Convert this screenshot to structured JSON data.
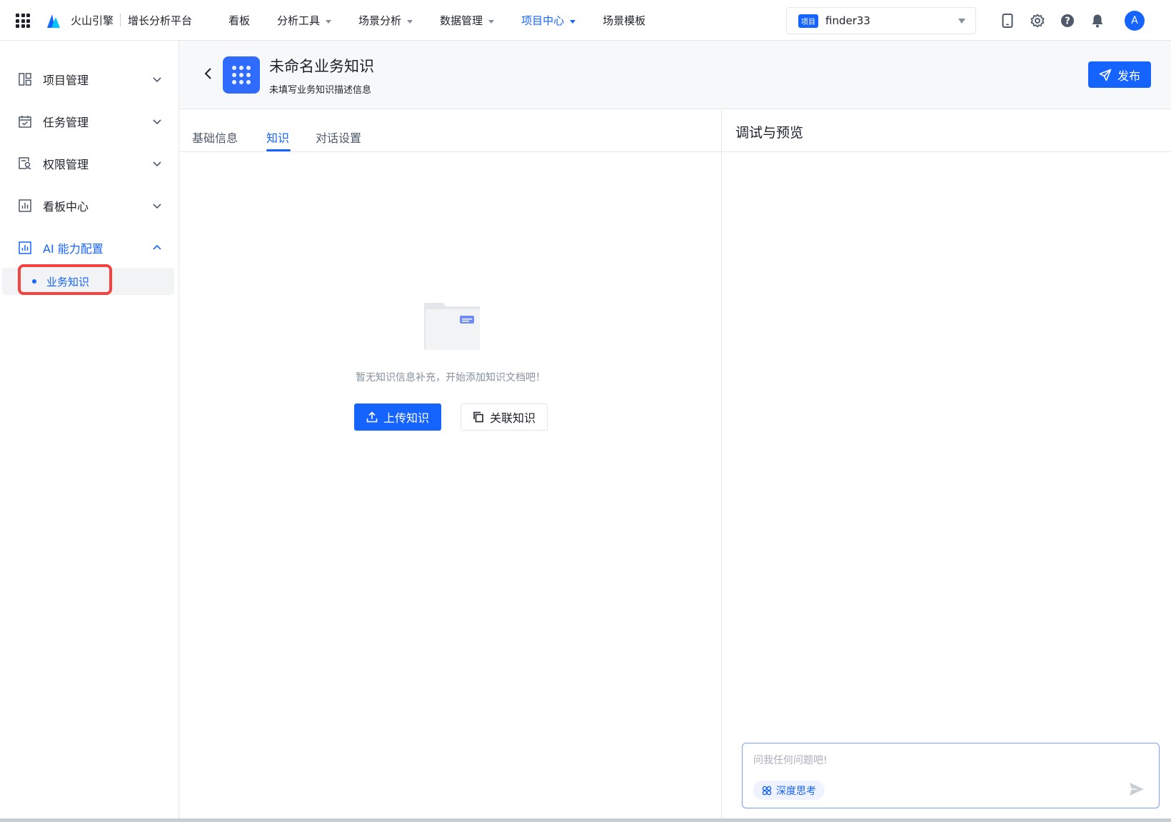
{
  "topbar": {
    "brand": "火山引擎",
    "platform": "增长分析平台",
    "nav": [
      {
        "label": "看板",
        "has_menu": false,
        "active": false
      },
      {
        "label": "分析工具",
        "has_menu": true,
        "active": false
      },
      {
        "label": "场景分析",
        "has_menu": true,
        "active": false
      },
      {
        "label": "数据管理",
        "has_menu": true,
        "active": false
      },
      {
        "label": "项目中心",
        "has_menu": true,
        "active": true
      },
      {
        "label": "场景模板",
        "has_menu": false,
        "active": false
      }
    ],
    "project_badge": "项目",
    "project_name": "finder33",
    "avatar_letter": "A",
    "icons": [
      "mobile-icon",
      "gear-icon",
      "help-icon",
      "bell-icon"
    ]
  },
  "sidebar": {
    "items": [
      {
        "label": "项目管理",
        "icon": "layout-icon",
        "expanded": false
      },
      {
        "label": "任务管理",
        "icon": "calendar-icon",
        "expanded": false
      },
      {
        "label": "权限管理",
        "icon": "user-search-icon",
        "expanded": false
      },
      {
        "label": "看板中心",
        "icon": "chart-icon",
        "expanded": false
      },
      {
        "label": "AI 能力配置",
        "icon": "ai-chart-icon",
        "expanded": true
      }
    ],
    "sub_item": {
      "label": "业务知识",
      "selected": true
    }
  },
  "header": {
    "title": "未命名业务知识",
    "description": "未填写业务知识描述信息",
    "publish_label": "发布"
  },
  "tabs": [
    {
      "label": "基础信息",
      "active": false
    },
    {
      "label": "知识",
      "active": true
    },
    {
      "label": "对话设置",
      "active": false
    }
  ],
  "empty_state": {
    "text": "暂无知识信息补充，开始添加知识文档吧！",
    "upload_label": "上传知识",
    "link_label": "关联知识"
  },
  "preview": {
    "title": "调试与预览",
    "input_placeholder": "问我任何问题吧!",
    "deep_think_label": "深度思考"
  },
  "colors": {
    "accent": "#1664ff",
    "highlight": "#f5413f",
    "text": "#1d2129",
    "muted": "#86909c"
  }
}
